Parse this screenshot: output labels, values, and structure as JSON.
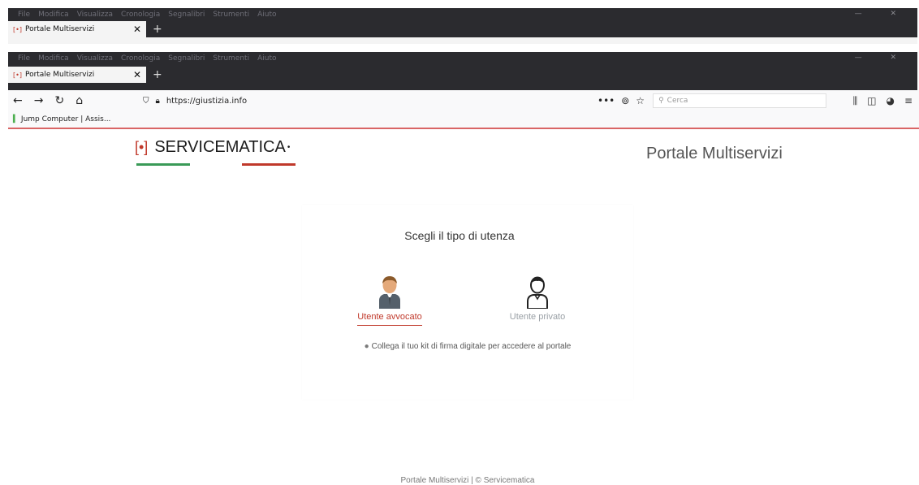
{
  "browser": {
    "menu_items": [
      "File",
      "Modifica",
      "Visualizza",
      "Cronologia",
      "Segnalibri",
      "Strumenti",
      "Aiuto"
    ],
    "tab": {
      "title": "Portale Multiservizi",
      "favicon": "[•]"
    },
    "new_tab": "+",
    "nav": {
      "back": "←",
      "forward": "→",
      "reload": "↻",
      "home": "⌂"
    },
    "url": "https://giustizia.info",
    "page_actions": [
      "•••",
      "⊚",
      "☆"
    ],
    "search_placeholder": "Cerca",
    "toolbar_icons": [
      "library-icon",
      "sidebar-icon",
      "extension-icon",
      "menu-icon"
    ],
    "bookmark": "Jump Computer | Assis..."
  },
  "site": {
    "logo_text": "SERVICEMATICA",
    "logo_mark": "[•]",
    "logo_sup": "•",
    "portal_title": "Portale Multiservizi",
    "prompt": "Scegli il tipo di utenza",
    "user_lawyer": "Utente avvocato",
    "user_private": "Utente privato",
    "hint": "Collega il tuo kit di firma digitale per accedere al portale",
    "footer": "Portale Multiservizi | © Servicematica"
  },
  "colors": {
    "brand_red": "#c0392b",
    "brand_green": "#3a9a57",
    "chrome_dark": "#2b2b2f"
  }
}
